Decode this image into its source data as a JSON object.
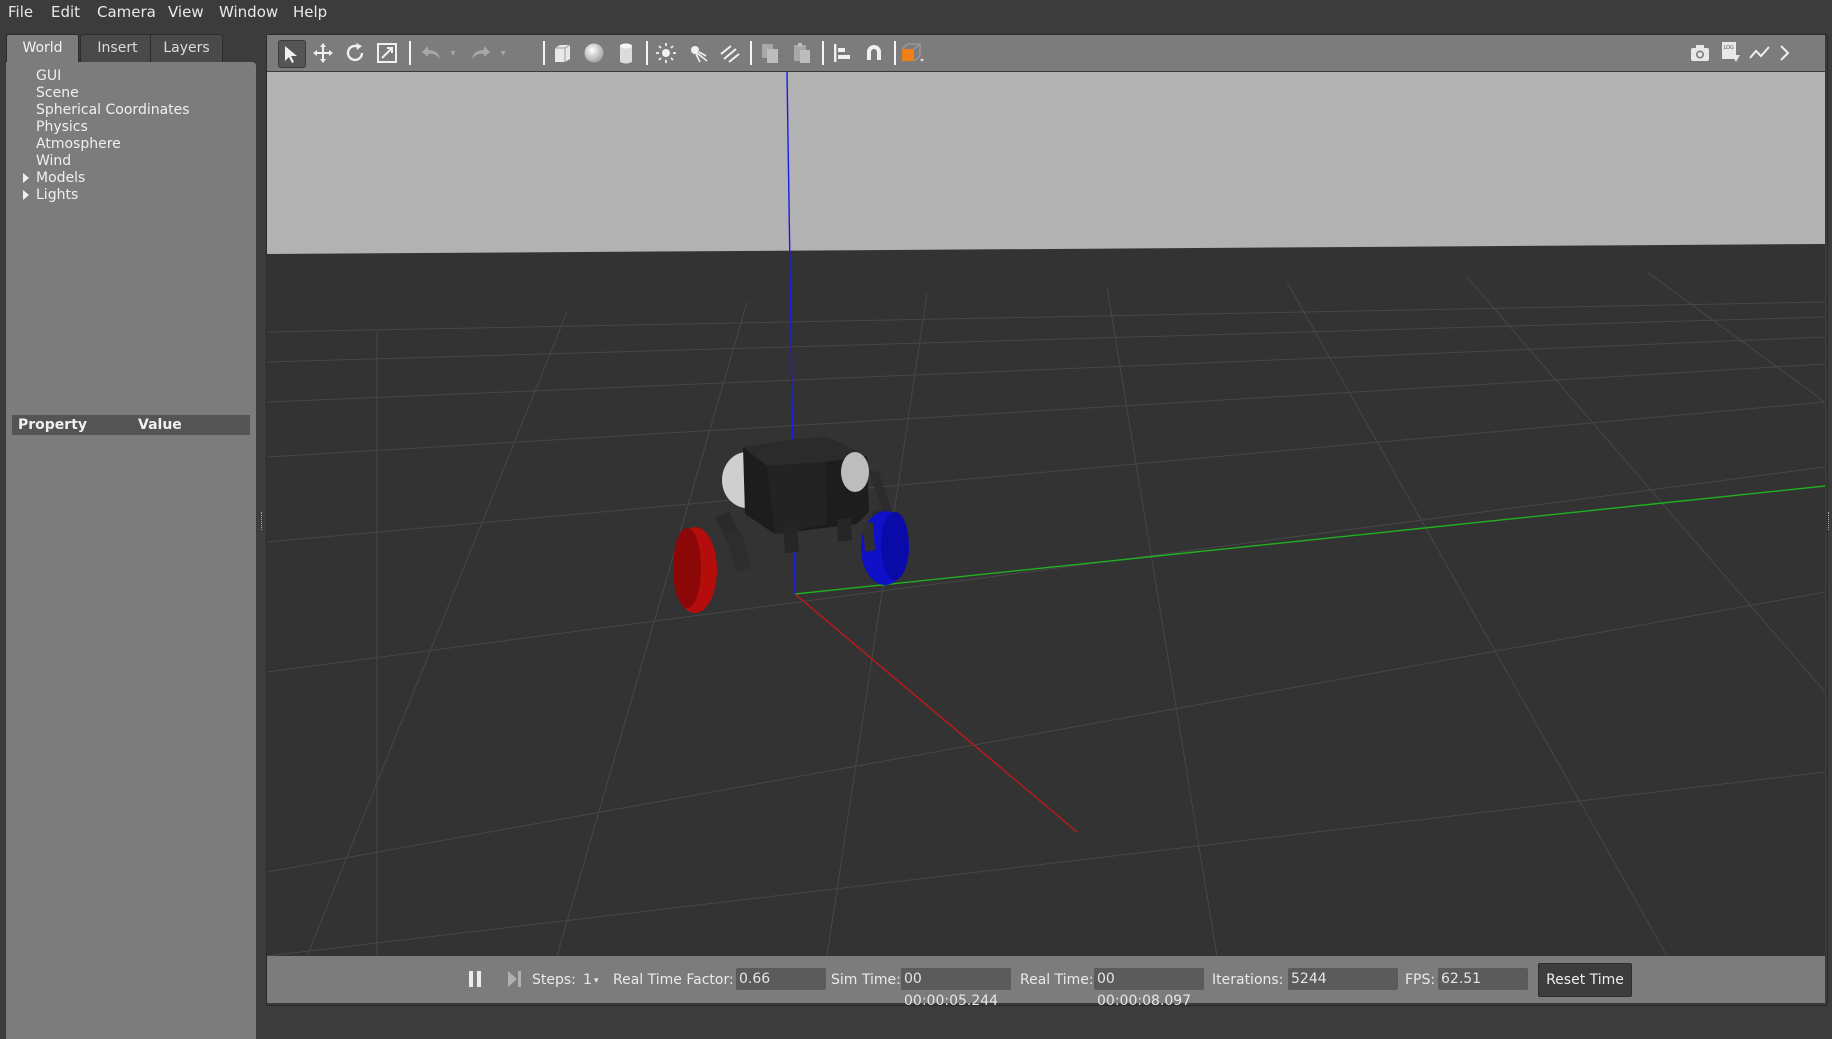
{
  "menu": [
    "File",
    "Edit",
    "Camera",
    "View",
    "Window",
    "Help"
  ],
  "left_panel": {
    "tabs": [
      "World",
      "Insert",
      "Layers"
    ],
    "active_tab": "World",
    "tree_items": [
      "GUI",
      "Scene",
      "Spherical Coordinates",
      "Physics",
      "Atmosphere",
      "Wind",
      "Models",
      "Lights"
    ],
    "property_header": {
      "property": "Property",
      "value": "Value"
    }
  },
  "toolbar": {
    "left_icons": [
      "select-arrow-icon",
      "translate-icon",
      "rotate-icon",
      "scale-icon",
      "undo-icon",
      "undo-dropdown-icon",
      "redo-icon",
      "redo-dropdown-icon",
      "box-icon",
      "sphere-icon",
      "cylinder-icon",
      "point-light-icon",
      "spot-light-icon",
      "directional-light-icon",
      "copy-icon",
      "paste-icon",
      "align-icon",
      "snap-magnet-icon",
      "view-angle-icon"
    ],
    "right_icons": [
      "screenshot-camera-icon",
      "log-icon",
      "plot-icon",
      "more-icon"
    ]
  },
  "colors": {
    "sky": "#b2b2b2",
    "ground": "#333333",
    "axis_x": "#c01818",
    "axis_y": "#20b020",
    "axis_z": "#1a1ae6",
    "left_wheel": "#b50c0c",
    "right_wheel": "#1010c8",
    "accent_orange": "#f07f1a"
  },
  "bottom_bar": {
    "steps_label": "Steps:",
    "steps_value": "1",
    "rtf_label": "Real Time Factor:",
    "rtf_value": "0.66",
    "sim_time_label": "Sim Time:",
    "sim_time_value": "00 00:00:05.244",
    "real_time_label": "Real Time:",
    "real_time_value": "00 00:00:08.097",
    "iterations_label": "Iterations:",
    "iterations_value": "5244",
    "fps_label": "FPS:",
    "fps_value": "62.51",
    "reset_label": "Reset Time"
  }
}
